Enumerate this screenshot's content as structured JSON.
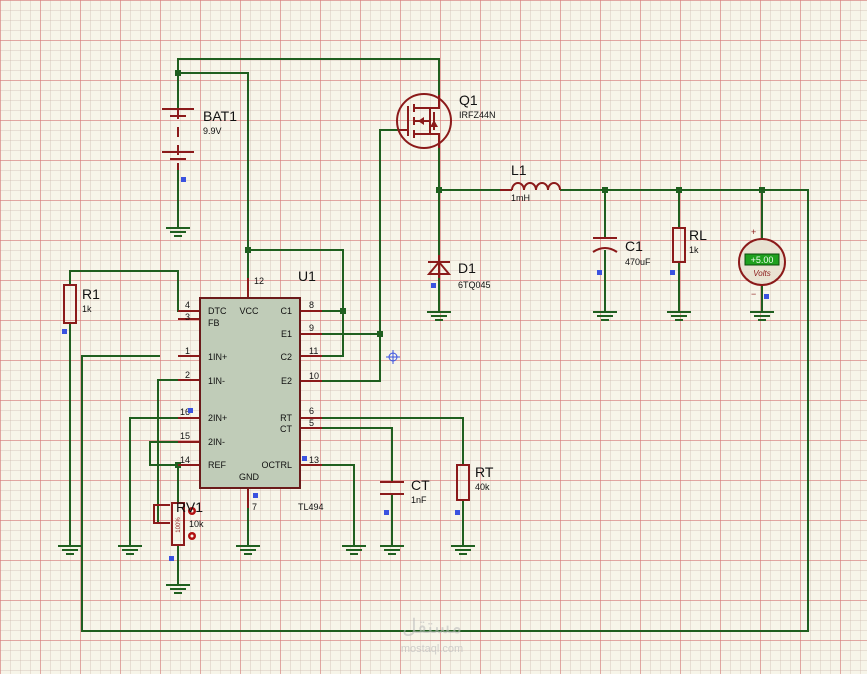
{
  "components": {
    "bat1": {
      "ref": "BAT1",
      "value": "9.9V"
    },
    "q1": {
      "ref": "Q1",
      "value": "IRFZ44N"
    },
    "l1": {
      "ref": "L1",
      "value": "1mH"
    },
    "d1": {
      "ref": "D1",
      "value": "6TQ045"
    },
    "c1": {
      "ref": "C1",
      "value": "470uF"
    },
    "rl": {
      "ref": "RL",
      "value": "1k"
    },
    "r1": {
      "ref": "R1",
      "value": "1k"
    },
    "u1": {
      "ref": "U1",
      "value": "TL494"
    },
    "ct": {
      "ref": "CT",
      "value": "1nF"
    },
    "rt": {
      "ref": "RT",
      "value": "40k"
    },
    "rv1": {
      "ref": "RV1",
      "value": "10k",
      "wiper": "100%"
    },
    "voltmeter": {
      "reading": "+5.00",
      "unit": "Volts",
      "plus": "+",
      "minus": "−"
    }
  },
  "u1_pins": {
    "left": [
      {
        "num": "4",
        "name": "DTC"
      },
      {
        "num": "3",
        "name": "FB"
      },
      {
        "num": "1",
        "name": "1IN+"
      },
      {
        "num": "2",
        "name": "1IN-"
      },
      {
        "num": "16",
        "name": "2IN+"
      },
      {
        "num": "15",
        "name": "2IN-"
      },
      {
        "num": "14",
        "name": "REF"
      }
    ],
    "right": [
      {
        "num": "8",
        "name": "C1"
      },
      {
        "num": "9",
        "name": "E1"
      },
      {
        "num": "11",
        "name": "C2"
      },
      {
        "num": "10",
        "name": "E2"
      },
      {
        "num": "6",
        "name": "RT"
      },
      {
        "num": "5",
        "name": "CT"
      },
      {
        "num": "13",
        "name": "OCTRL"
      }
    ],
    "top": {
      "num": "12",
      "name": "VCC"
    },
    "bottom": {
      "num": "7",
      "name": "GND"
    }
  },
  "colors": {
    "wire": "#1f5f1f",
    "component": "#8b1a1a",
    "ic_body": "#c0ccb8",
    "voltmeter_display": "#1fa01f",
    "marker": "#3a52e0"
  },
  "watermark": {
    "line1": "مستقل",
    "line2": "mostaql.com"
  }
}
